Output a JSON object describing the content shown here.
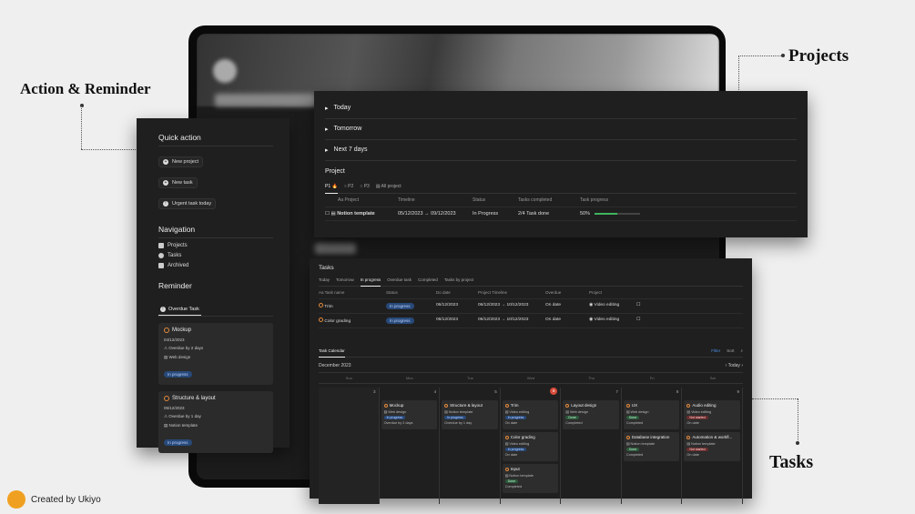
{
  "callouts": {
    "action_reminder": "Action & Reminder",
    "projects": "Projects",
    "tasks": "Tasks"
  },
  "footer": {
    "credit": "Created by Ukiyo"
  },
  "quick_action": {
    "title": "Quick action",
    "buttons": [
      "New project",
      "New task",
      "Urgent task today"
    ]
  },
  "navigation": {
    "title": "Navigation",
    "items": [
      "Projects",
      "Tasks",
      "Archived"
    ]
  },
  "reminder": {
    "title": "Reminder",
    "tab": "Overdue Task",
    "cards": [
      {
        "title": "Mockup",
        "date": "04/12/2023",
        "overdue": "Overdue by 2 days",
        "project": "Web design",
        "status": "In progress"
      },
      {
        "title": "Structure & layout",
        "date": "05/12/2023",
        "overdue": "Overdue by 1 day",
        "project": "Notion template",
        "status": "In progress"
      }
    ]
  },
  "projects_panel": {
    "toggles": [
      "Today",
      "Tomorrow",
      "Next 7 days"
    ],
    "section_title": "Project",
    "tabs": [
      "P1 🔥",
      "P2",
      "P3",
      "All project"
    ],
    "columns": [
      "Aa Project",
      "Timeline",
      "Status",
      "Tasks completed",
      "Task progress"
    ],
    "rows": [
      {
        "name": "Notion template",
        "timeline": "05/12/2023 → 09/12/2023",
        "status": "In Progress",
        "completed": "2/4 Task done",
        "progress": "50%",
        "progress_value": 0.5
      }
    ]
  },
  "tasks_panel": {
    "title": "Tasks",
    "tabs": [
      "Today",
      "Tomorrow",
      "In progress",
      "Overdue task",
      "Completed",
      "Tasks by project"
    ],
    "columns": [
      "Aa Task name",
      "Status",
      "Do date",
      "Project Timeline",
      "Overdue",
      "Project",
      ""
    ],
    "rows": [
      {
        "name": "Trim",
        "status": "In progress",
        "do_date": "06/12/2023",
        "timeline": "06/12/2023 → 10/12/2023",
        "overdue": "On date",
        "project": "Video editing"
      },
      {
        "name": "Color grading",
        "status": "In progress",
        "do_date": "06/12/2023",
        "timeline": "06/12/2023 → 10/12/2023",
        "overdue": "On date",
        "project": "Video editing"
      }
    ],
    "calendar_tab": "Task Calendar",
    "month": "December 2023",
    "controls": {
      "filter": "Filter",
      "sort": "Sort",
      "today": "Today"
    },
    "weekdays": [
      "Sun",
      "Mon",
      "Tue",
      "Wed",
      "Thu",
      "Fri",
      "Sat"
    ],
    "days": [
      {
        "num": "3",
        "events": []
      },
      {
        "num": "4",
        "events": [
          {
            "title": "Mockup",
            "lines": [
              "Web design"
            ],
            "pill": "In progress",
            "pill_kind": "blue",
            "extra": "Overdue by 2 days"
          }
        ]
      },
      {
        "num": "5",
        "events": [
          {
            "title": "Structure & layout",
            "lines": [
              "Notion template"
            ],
            "pill": "In progress",
            "pill_kind": "blue",
            "extra": "Overdue by 1 day"
          }
        ]
      },
      {
        "num": "6",
        "today": true,
        "events": [
          {
            "title": "Trim",
            "lines": [
              "Video editing"
            ],
            "pill": "In progress",
            "pill_kind": "blue",
            "extra": "On date"
          },
          {
            "title": "Color grading",
            "lines": [
              "Video editing"
            ],
            "pill": "In progress",
            "pill_kind": "blue",
            "extra": "On date"
          },
          {
            "title": "Input",
            "lines": [
              "Notion template"
            ],
            "pill": "Done",
            "pill_kind": "green",
            "extra": "Completed"
          }
        ]
      },
      {
        "num": "7",
        "events": [
          {
            "title": "Layout design",
            "lines": [
              "Web design"
            ],
            "pill": "Done",
            "pill_kind": "green",
            "extra": "Completed"
          }
        ]
      },
      {
        "num": "8",
        "events": [
          {
            "title": "UX",
            "lines": [
              "Web design"
            ],
            "pill": "Done",
            "pill_kind": "green",
            "extra": "Completed"
          },
          {
            "title": "Database integration",
            "lines": [
              "Notion template"
            ],
            "pill": "Done",
            "pill_kind": "green",
            "extra": "Completed"
          }
        ]
      },
      {
        "num": "9",
        "events": [
          {
            "title": "Audio editing",
            "lines": [
              "Video editing"
            ],
            "pill": "Not started",
            "pill_kind": "red",
            "extra": "On date"
          },
          {
            "title": "Automation & workfl...",
            "lines": [
              "Notion template"
            ],
            "pill": "Not started",
            "pill_kind": "red",
            "extra": "On date"
          }
        ]
      }
    ]
  }
}
